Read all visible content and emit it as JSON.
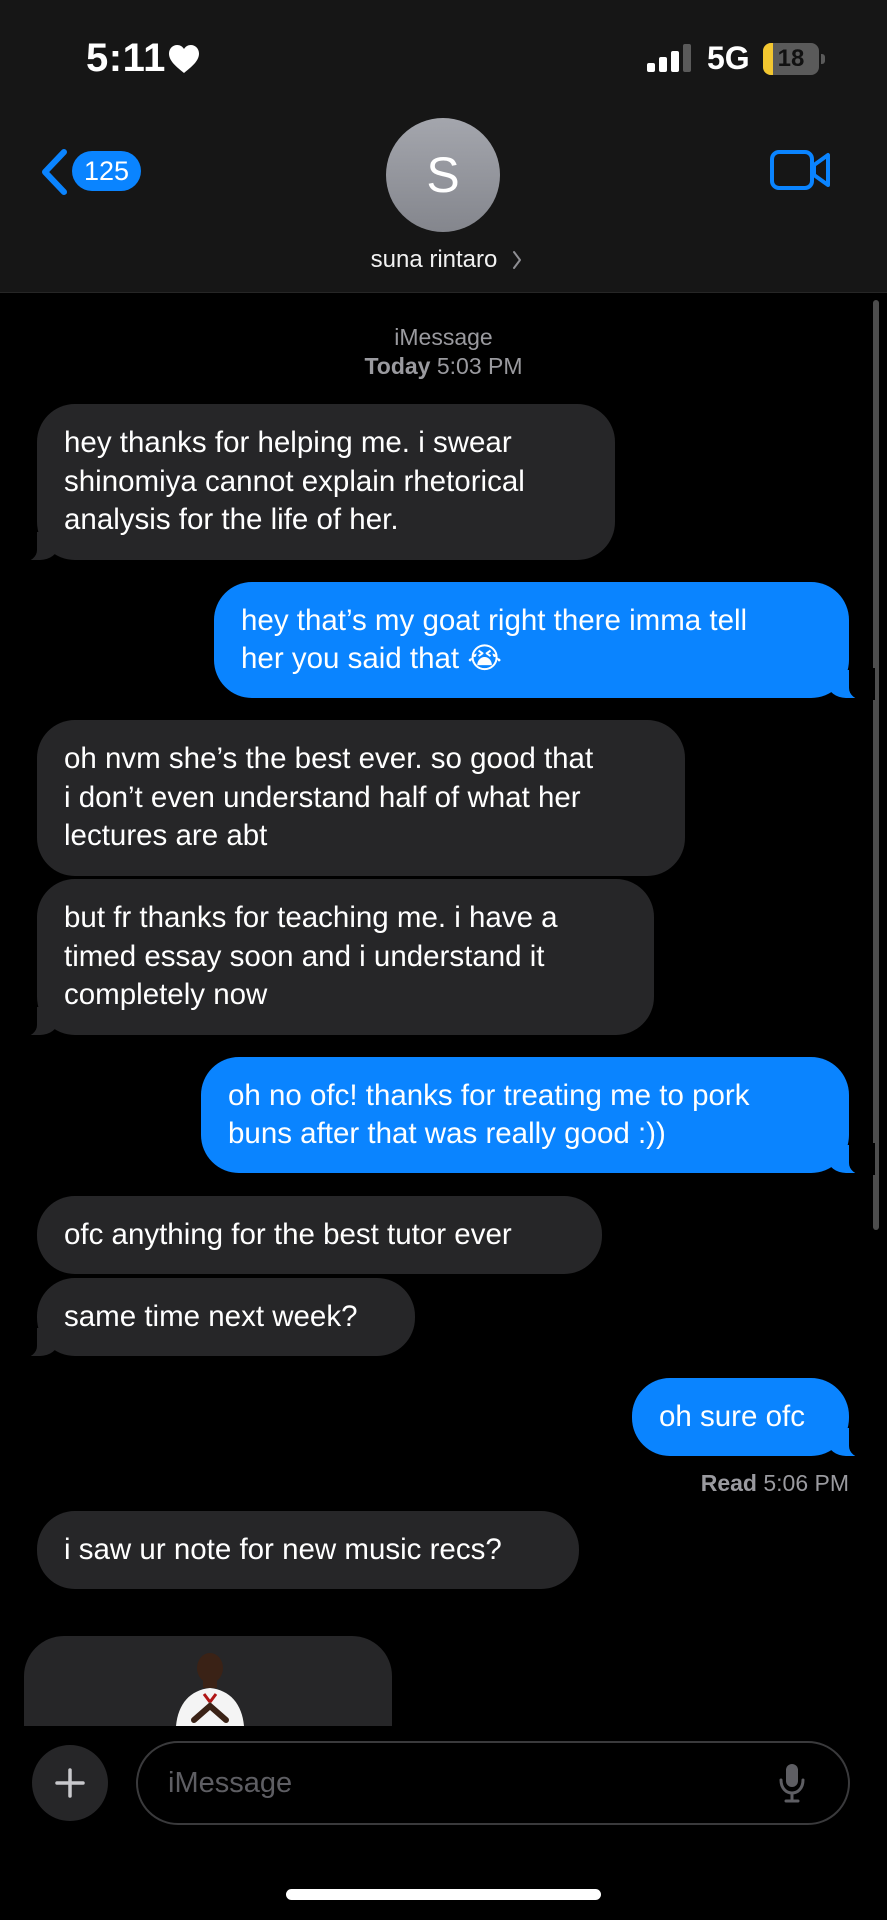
{
  "status_bar": {
    "time": "5:11",
    "network": "5G",
    "battery_level": "18",
    "battery_fraction": 0.18,
    "signal_bars_active": 3,
    "signal_bars_total": 4
  },
  "header": {
    "back_count": "125",
    "avatar_initial": "S",
    "contact_name": "suna rintaro",
    "accent_color": "#0a84ff",
    "video_icon": "video-camera-icon"
  },
  "timestamp": {
    "service": "iMessage",
    "day": "Today",
    "time": "5:03 PM"
  },
  "messages": [
    {
      "direction": "incoming",
      "text": "hey thanks for helping me. i swear\nshinomiya cannot explain rhetorical\nanalysis for the life of her."
    },
    {
      "direction": "outgoing",
      "text": "hey that’s my goat right there imma tell\nher you said that 😭"
    },
    {
      "direction": "incoming",
      "text": "oh nvm she’s the best ever. so good that\ni don’t even understand half of what her\nlectures are abt"
    },
    {
      "direction": "incoming",
      "text": "but fr thanks for teaching me. i have a\ntimed essay soon and i understand it\ncompletely now"
    },
    {
      "direction": "outgoing",
      "text": "oh no ofc! thanks for treating me to pork\nbuns after that was really good :))"
    },
    {
      "direction": "incoming",
      "text": "ofc anything for the best tutor ever"
    },
    {
      "direction": "incoming",
      "text": "same time next week?"
    },
    {
      "direction": "outgoing",
      "text": "oh sure ofc"
    },
    {
      "direction": "incoming",
      "text": "i saw ur note for new music recs?"
    }
  ],
  "read_receipt": {
    "label": "Read",
    "time": "5:06 PM"
  },
  "input": {
    "placeholder": "iMessage",
    "add_icon": "plus-icon",
    "mic_icon": "microphone-icon"
  }
}
